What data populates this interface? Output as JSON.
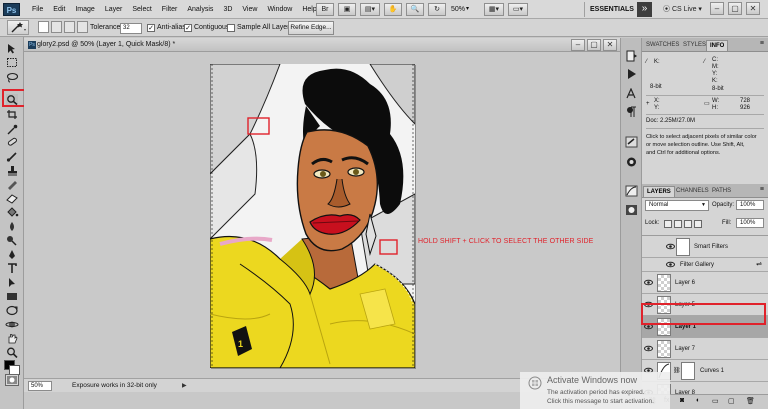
{
  "app": {
    "logo_text": "Ps",
    "menu": [
      "File",
      "Edit",
      "Image",
      "Layer",
      "Select",
      "Filter",
      "Analysis",
      "3D",
      "View",
      "Window",
      "Help"
    ],
    "zoom_menu": "50%",
    "workspace": "ESSENTIALS",
    "cs_live": "CS Live"
  },
  "options": {
    "tolerance_label": "Tolerance:",
    "tolerance_value": "32",
    "anti_alias_label": "Anti-alias",
    "anti_alias_checked": true,
    "contiguous_label": "Contiguous",
    "contiguous_checked": true,
    "sample_all_label": "Sample All Layers",
    "sample_all_checked": false,
    "refine_edge_label": "Refine Edge..."
  },
  "document": {
    "tab_title": "glory2.psd @ 50% (Layer 1, Quick Mask/8) *",
    "annotation": "HOLD SHIFT + CLICK TO SELECT THE OTHER SIDE"
  },
  "status": {
    "zoom": "50%",
    "message": "Exposure works in 32-bit only"
  },
  "info_panel": {
    "tabs": [
      "SWATCHES",
      "STYLES",
      "INFO"
    ],
    "active_tab": "INFO",
    "k_label": "K:",
    "c_label": "C:",
    "m_label": "M:",
    "y_label": "Y:",
    "k2_label": "K:",
    "bit_left": "8-bit",
    "bit_right": "8-bit",
    "x_label": "X:",
    "y2_label": "Y:",
    "w_label": "W:",
    "w_value": "728",
    "h_label": "H:",
    "h_value": "926",
    "doc_size": "Doc: 2.25M/27.0M",
    "help_text_1": "Click to select adjacent pixels of similar color",
    "help_text_2": "or move selection outline.  Use Shift, Alt,",
    "help_text_3": "and Ctrl for additional options."
  },
  "layers_panel": {
    "tabs": [
      "LAYERS",
      "CHANNELS",
      "PATHS"
    ],
    "active_tab": "LAYERS",
    "blend_mode": "Normal",
    "opacity_label": "Opacity:",
    "opacity_value": "100%",
    "lock_label": "Lock:",
    "fill_label": "Fill:",
    "fill_value": "100%",
    "rows": [
      {
        "name": "Smart Filters",
        "bold": false
      },
      {
        "name": "Filter Gallery",
        "bold": false
      },
      {
        "name": "Layer 6",
        "bold": false
      },
      {
        "name": "Layer 5",
        "bold": false
      },
      {
        "name": "Layer 1",
        "bold": true
      },
      {
        "name": "Layer 7",
        "bold": false
      },
      {
        "name": "Curves 1",
        "bold": false
      },
      {
        "name": "Layer 8",
        "bold": false
      }
    ]
  },
  "windows_activation": {
    "title": "Activate Windows now",
    "line1": "The activation period has expired.",
    "line2": "Click this message to start activation."
  },
  "colors": {
    "highlight_red": "#e0222b",
    "yellow_shirt": "#ecd81f",
    "lips": "#c8101e",
    "skin": "#c97a45"
  }
}
